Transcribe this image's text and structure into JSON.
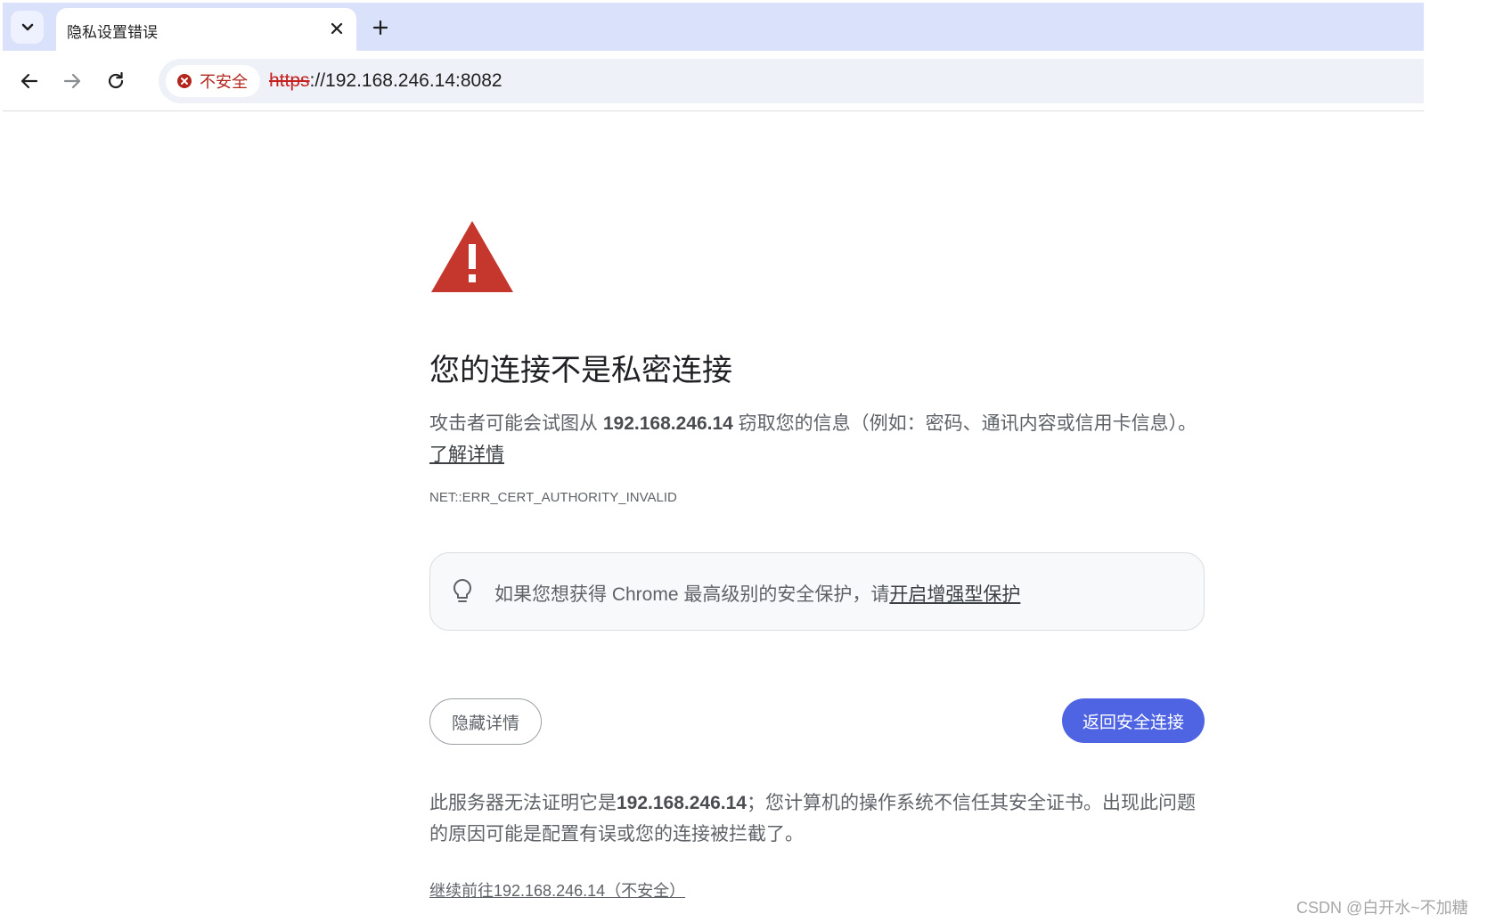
{
  "tab": {
    "title": "隐私设置错误"
  },
  "toolbar": {
    "security_chip_label": "不安全",
    "url_scheme": "https",
    "url_rest": "://192.168.246.14:8082"
  },
  "page": {
    "heading": "您的连接不是私密连接",
    "desc_before": "攻击者可能会试图从 ",
    "desc_host": "192.168.246.14",
    "desc_after": " 窃取您的信息（例如：密码、通讯内容或信用卡信息）。",
    "learn_more": "了解详情",
    "error_code": "NET::ERR_CERT_AUTHORITY_INVALID",
    "tip_text": "如果您想获得 Chrome 最高级别的安全保护，请",
    "tip_link": "开启增强型保护",
    "hide_details_button": "隐藏详情",
    "back_to_safety_button": "返回安全连接",
    "details_before": "此服务器无法证明它是",
    "details_host": "192.168.246.14",
    "details_after": "；您计算机的操作系统不信任其安全证书。出现此问题的原因可能是配置有误或您的连接被拦截了。",
    "proceed_link": "继续前往192.168.246.14（不安全）"
  },
  "watermark": "CSDN @白开水~不加糖",
  "colors": {
    "warning_red": "#c5372c",
    "primary_button": "#4f64e2",
    "tabstrip": "#d9e1fb"
  }
}
